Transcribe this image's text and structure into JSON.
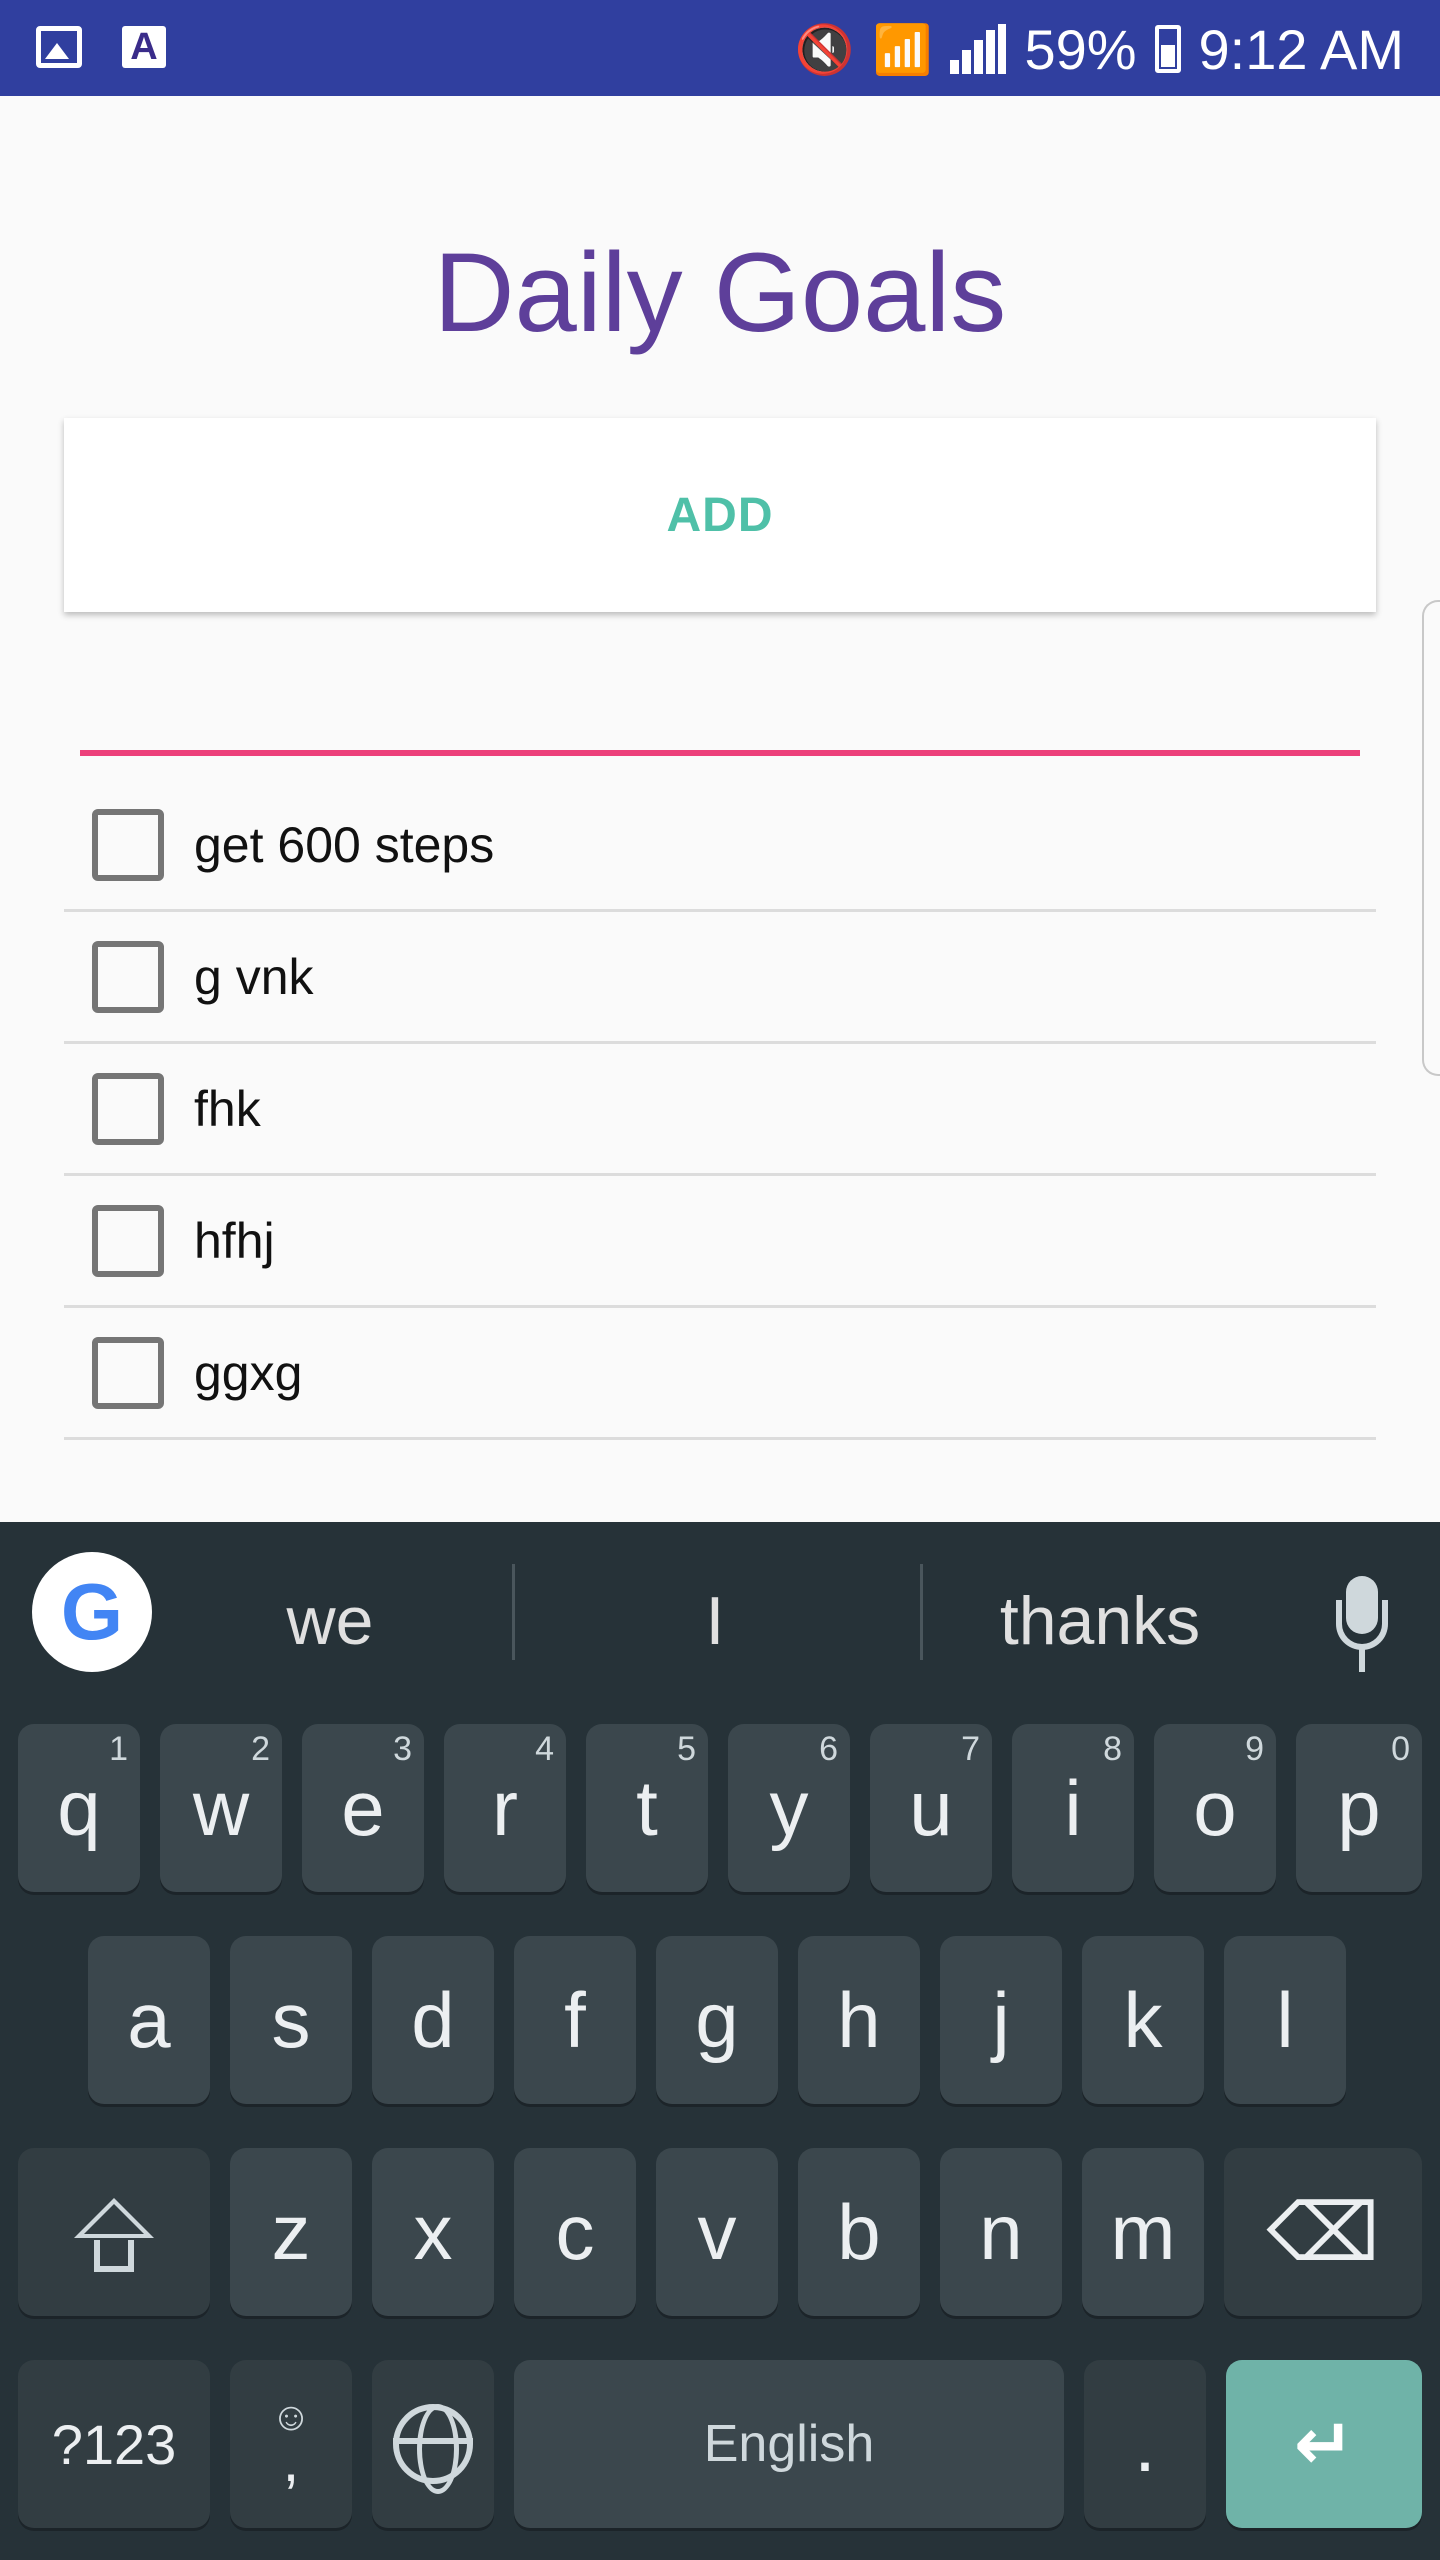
{
  "status_bar": {
    "battery": "59%",
    "time": "9:12 AM",
    "left_icons": [
      "image-notification-icon",
      "app-a-notification-icon"
    ],
    "right_icons": [
      "vibrate-mute-icon",
      "wifi-icon",
      "cell-signal-icon",
      "battery-charging-icon"
    ]
  },
  "app": {
    "title": "Daily Goals",
    "add_label": "ADD",
    "input_value": "",
    "accent_color": "#5e3f9a",
    "button_text_color": "#4fc0a8",
    "input_underline_color": "#ec407a"
  },
  "goals": [
    {
      "label": "get 600 steps",
      "checked": false
    },
    {
      "label": "g vnk",
      "checked": false
    },
    {
      "label": "fhk",
      "checked": false
    },
    {
      "label": "hfhj",
      "checked": false
    },
    {
      "label": "ggxg",
      "checked": false
    }
  ],
  "keyboard": {
    "suggestions": [
      "we",
      "I",
      "thanks"
    ],
    "row1": [
      {
        "key": "q",
        "hint": "1"
      },
      {
        "key": "w",
        "hint": "2"
      },
      {
        "key": "e",
        "hint": "3"
      },
      {
        "key": "r",
        "hint": "4"
      },
      {
        "key": "t",
        "hint": "5"
      },
      {
        "key": "y",
        "hint": "6"
      },
      {
        "key": "u",
        "hint": "7"
      },
      {
        "key": "i",
        "hint": "8"
      },
      {
        "key": "o",
        "hint": "9"
      },
      {
        "key": "p",
        "hint": "0"
      }
    ],
    "row2": [
      "a",
      "s",
      "d",
      "f",
      "g",
      "h",
      "j",
      "k",
      "l"
    ],
    "row3": [
      "z",
      "x",
      "c",
      "v",
      "b",
      "n",
      "m"
    ],
    "symbols_label": "?123",
    "comma_label": ",",
    "emoji_label": "☺",
    "space_label": "English",
    "period_label": ".",
    "backspace_label": "⌫",
    "enter_label": "↵",
    "google_label": "G"
  }
}
